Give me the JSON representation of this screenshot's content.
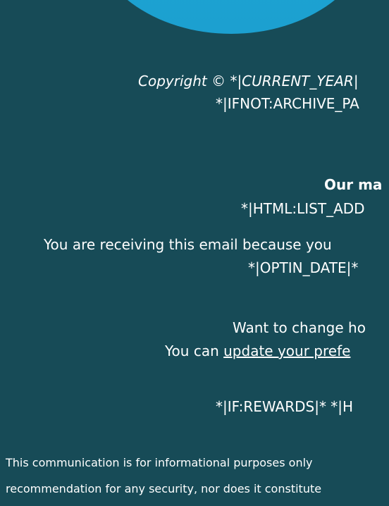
{
  "colors": {
    "background": "#174B57",
    "circle_top": "#1aa9d6",
    "circle_bottom": "#1ca0d0",
    "text": "#ffffff"
  },
  "footer": {
    "copyright": "Copyright © *|CURRENT_YEAR|",
    "archive_tag": "*|IFNOT:ARCHIVE_PA",
    "mailing_heading": "Our ma",
    "list_address": "*|HTML:LIST_ADD",
    "receiving_text": "You are receiving this email because you",
    "optin_date": "*|OPTIN_DATE|*",
    "change_text": "Want to change ho",
    "update_prefix": "You can ",
    "update_link": "update your prefe",
    "rewards": "*|IF:REWARDS|* *|H"
  },
  "disclaimer": {
    "line1": "This communication is for informational purposes only",
    "line2": "recommendation for any security, nor does it constitute"
  }
}
